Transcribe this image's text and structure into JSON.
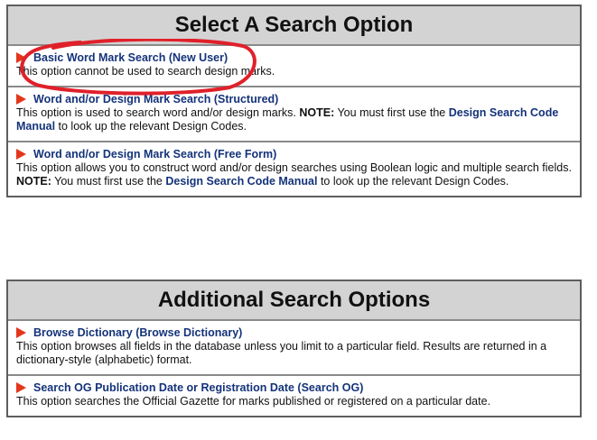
{
  "colors": {
    "header_bg": "#d3d3d3",
    "link": "#14337a",
    "flag": "#e3361b",
    "annotation": "#e0202a"
  },
  "panels": [
    {
      "header": "Select A Search Option",
      "rows": [
        {
          "icon": "flag-icon",
          "title": "Basic Word Mark Search (New User)",
          "desc_1": "This option cannot be used to search design marks."
        },
        {
          "icon": "flag-icon",
          "title": "Word and/or Design Mark Search (Structured)",
          "desc_1": "This option is used to search word and/or design marks. ",
          "note_label": "NOTE:",
          "desc_2": " You must first use the ",
          "link_2": "Design Search Code Manual",
          "desc_3": " to look up the relevant Design Codes."
        },
        {
          "icon": "flag-icon",
          "title": "Word and/or Design Mark Search (Free Form)",
          "desc_1": "This option allows you to construct word and/or design searches using Boolean logic and multiple search fields. ",
          "note_label": "NOTE:",
          "desc_2": " You must first use the ",
          "link_2": "Design Search Code Manual",
          "desc_3": " to look up the relevant Design Codes."
        }
      ]
    },
    {
      "header": "Additional Search Options",
      "rows": [
        {
          "icon": "flag-icon",
          "title": "Browse Dictionary (Browse Dictionary)",
          "desc_1": "This option browses all fields in the database unless you limit to a particular field. Results are returned in a dictionary-style (alphabetic) format."
        },
        {
          "icon": "flag-icon",
          "title": "Search OG Publication Date or Registration Date (Search OG)",
          "desc_1": "This option searches the Official Gazette for marks published or registered on a particular date."
        }
      ]
    }
  ]
}
